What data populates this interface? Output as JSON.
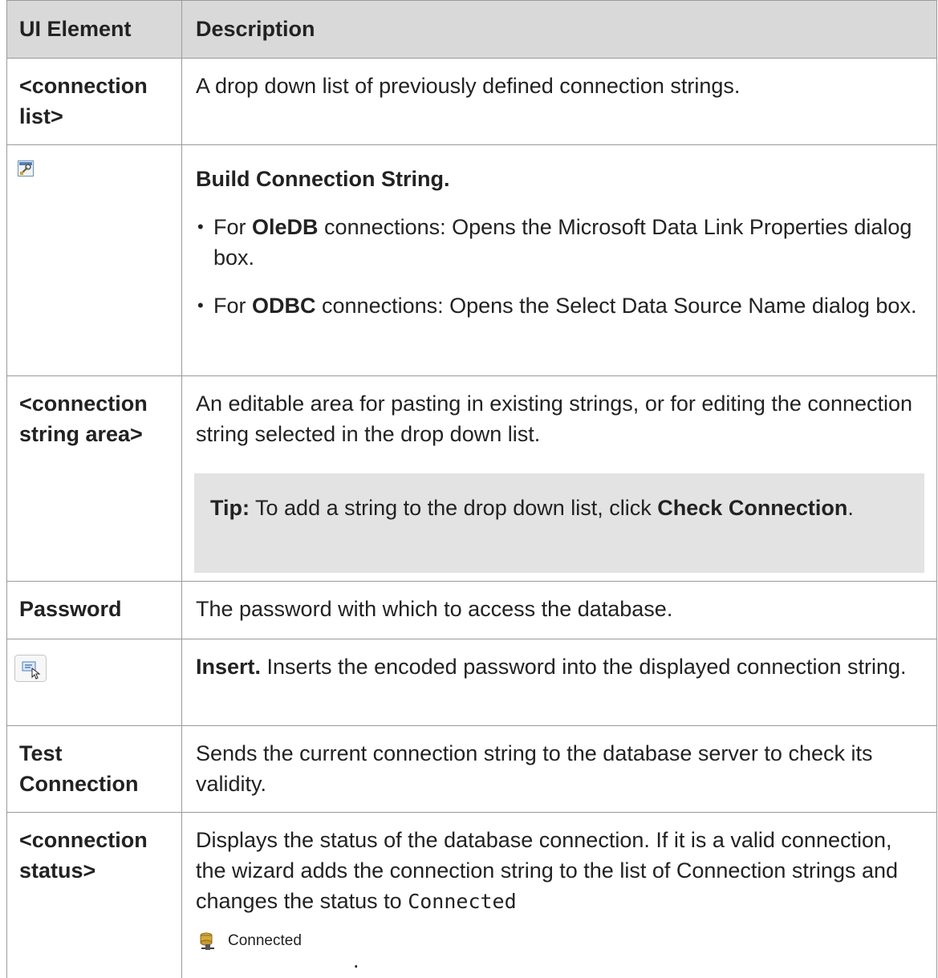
{
  "table": {
    "headers": [
      "UI Element",
      "Description"
    ],
    "rows": [
      {
        "element": "<connection list>",
        "description": "A drop down list of previously defined connection strings."
      },
      {
        "element_icon": "build-connection-string-icon",
        "title": "Build Connection String.",
        "bullets": [
          {
            "pre": "For ",
            "bold": "OleDB",
            "post": " connections: Opens the Microsoft Data Link Properties dialog box."
          },
          {
            "pre": "For ",
            "bold": "ODBC",
            "post": " connections: Opens the Select Data Source Name dialog box."
          }
        ]
      },
      {
        "element": "<connection string area>",
        "description": "An editable area for pasting in existing strings, or for editing the connection string selected in the drop down list.",
        "tip_label": "Tip:",
        "tip_text": " To add a string to the drop down list, click ",
        "tip_bold": "Check Connection",
        "tip_end": "."
      },
      {
        "element": "Password",
        "description": "The password with which to access the database."
      },
      {
        "element_icon": "insert-password-icon",
        "title": "Insert.",
        "description": " Inserts the encoded password into the displayed connection string."
      },
      {
        "element": "Test Connection",
        "description": "Sends the current connection string to the database server to check its validity."
      },
      {
        "element": "<connection status>",
        "description": "Displays the status of the database connection. If it is a valid connection, the wizard adds the connection string to the list of Connection strings and changes the status to ",
        "status_mono": "Connected",
        "status_icon": "database-connected-icon",
        "status_label": "Connected",
        "status_end": "."
      }
    ]
  },
  "colors": {
    "header_bg": "#d9d9d9",
    "tip_bg": "#e3e3e3",
    "border": "#9a9a9a"
  }
}
